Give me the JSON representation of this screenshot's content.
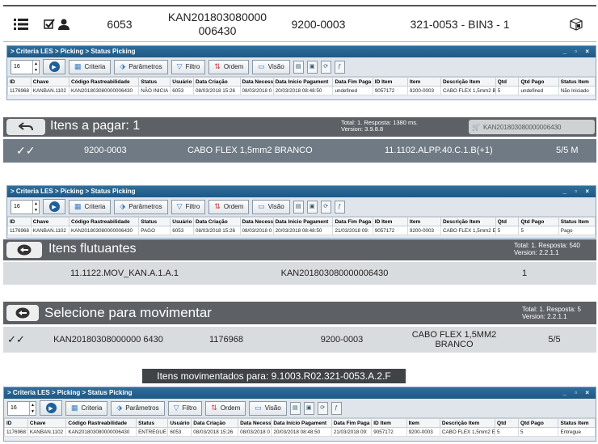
{
  "top": {
    "menu_icon": "list-icon",
    "check_icon": "check-square-icon",
    "user_icon": "user-icon",
    "number": "6053",
    "code": "KAN201803080000 006430",
    "item": "9200-0003",
    "location": "321-0053 - BIN3 - 1",
    "box_icon": "box-icon"
  },
  "criteria_windows": [
    {
      "breadcrumb": "> Criteria LES > Picking > Status Picking",
      "window_controls": "_ ▫ ×",
      "spin_value": "16",
      "buttons": {
        "criteria": "Criteria",
        "params": "Parâmetros",
        "filter": "Filtro",
        "order": "Ordem",
        "view": "Visão"
      },
      "columns": [
        "ID",
        "Chave",
        "Código Rastreabilidade",
        "Status",
        "Usuário",
        "Data Criação",
        "Data Necess",
        "Data Início Pagament",
        "Data Fim Paga",
        "ID Item",
        "Item",
        "Descrição Item",
        "Qtd",
        "Qtd Pago",
        "Status Item"
      ],
      "row": [
        "1176968",
        "KANBAN.1102",
        "KAN201803080000006430",
        "NÃO INICIA",
        "6053",
        "08/03/2018 15:26",
        "08/03/2018 0",
        "20/03/2018 08:48:50",
        "undefined",
        "9057172",
        "9200-0003",
        "CABO FLEX 1,5mm2 B",
        "5",
        "undefined",
        "Não Iniciado"
      ]
    },
    {
      "breadcrumb": "> Criteria LES > Picking > Status Picking",
      "window_controls": "_ ▫ ×",
      "spin_value": "16",
      "buttons": {
        "criteria": "Criteria",
        "params": "Parâmetros",
        "filter": "Filtro",
        "order": "Ordem",
        "view": "Visão"
      },
      "columns": [
        "ID",
        "Chave",
        "Código Rastreabilidade",
        "Status",
        "Usuário",
        "Data Criação",
        "Data Necess",
        "Data Início Pagament",
        "Data Fim Paga",
        "ID Item",
        "Item",
        "Descrição Item",
        "Qtd",
        "Qtd Pago",
        "Status Item"
      ],
      "row": [
        "1176968",
        "KANBAN.1102",
        "KAN201803080000006430",
        "PAGO",
        "6053",
        "08/03/2018 15:26",
        "08/03/2018 0",
        "20/03/2018 08:48:50",
        "21/03/2018 09:",
        "9057172",
        "9200-0003",
        "CABO FLEX 1,5mm2 E",
        "5",
        "5",
        "Pago"
      ]
    },
    {
      "breadcrumb": "> Criteria LES > Picking > Status Picking",
      "window_controls": "_ ▫ ×",
      "spin_value": "16",
      "buttons": {
        "criteria": "Criteria",
        "params": "Parâmetros",
        "filter": "Filtro",
        "order": "Ordem",
        "view": "Visão"
      },
      "columns": [
        "ID",
        "Chave",
        "Código Rastreabilidade",
        "Status",
        "Usuário",
        "Data Criação",
        "Data Necess",
        "Data Início Pagament",
        "Data Fim Paga",
        "ID Item",
        "Item",
        "Descrição Item",
        "Qtd",
        "Qtd Pago",
        "Status Item"
      ],
      "row": [
        "1176968",
        "KANBAN.1102",
        "KAN201803080000006430",
        "ENTREGUE",
        "6053",
        "08/03/2018 15:26",
        "08/03/2018 0",
        "20/03/2018 08:48:50",
        "21/03/2018 09:",
        "9057172",
        "9200-0003",
        "CABO FLEX 1,5mm2 E",
        "5",
        "5",
        "Entregue"
      ]
    }
  ],
  "pay": {
    "title": "Itens a pagar: 1",
    "total": "Total: 1. Resposta: 1380 ms.",
    "version": "Version: 3.9.8.8",
    "cart_code": "KAN201803080000006430",
    "row": {
      "item": "9200-0003",
      "desc": "CABO FLEX 1,5mm2 BRANCO",
      "loc": "11.1102.ALPP.40.C.1.B(+1)",
      "qty": "5/5 M"
    }
  },
  "floating": {
    "title": "Itens flutuantes",
    "total": "Total: 1. Resposta: 540",
    "version": "Version: 2.2.1.1",
    "row": {
      "loc": "11.1122.MOV_KAN.A.1.A.1",
      "code": "KAN201803080000006430",
      "qty": "1"
    }
  },
  "move": {
    "title": "Selecione para movimentar",
    "total": "Total: 1. Resposta: 5",
    "version": "Version: 2.2.1.1",
    "row": {
      "code": "KAN20180308000000 6430",
      "id": "1176968",
      "item": "9200-0003",
      "desc": "CABO FLEX 1,5MM2 BRANCO",
      "qty": "5/5"
    }
  },
  "moved_banner": "Itens movimentados para: 9.1003.R02.321-0053.A.2.F"
}
